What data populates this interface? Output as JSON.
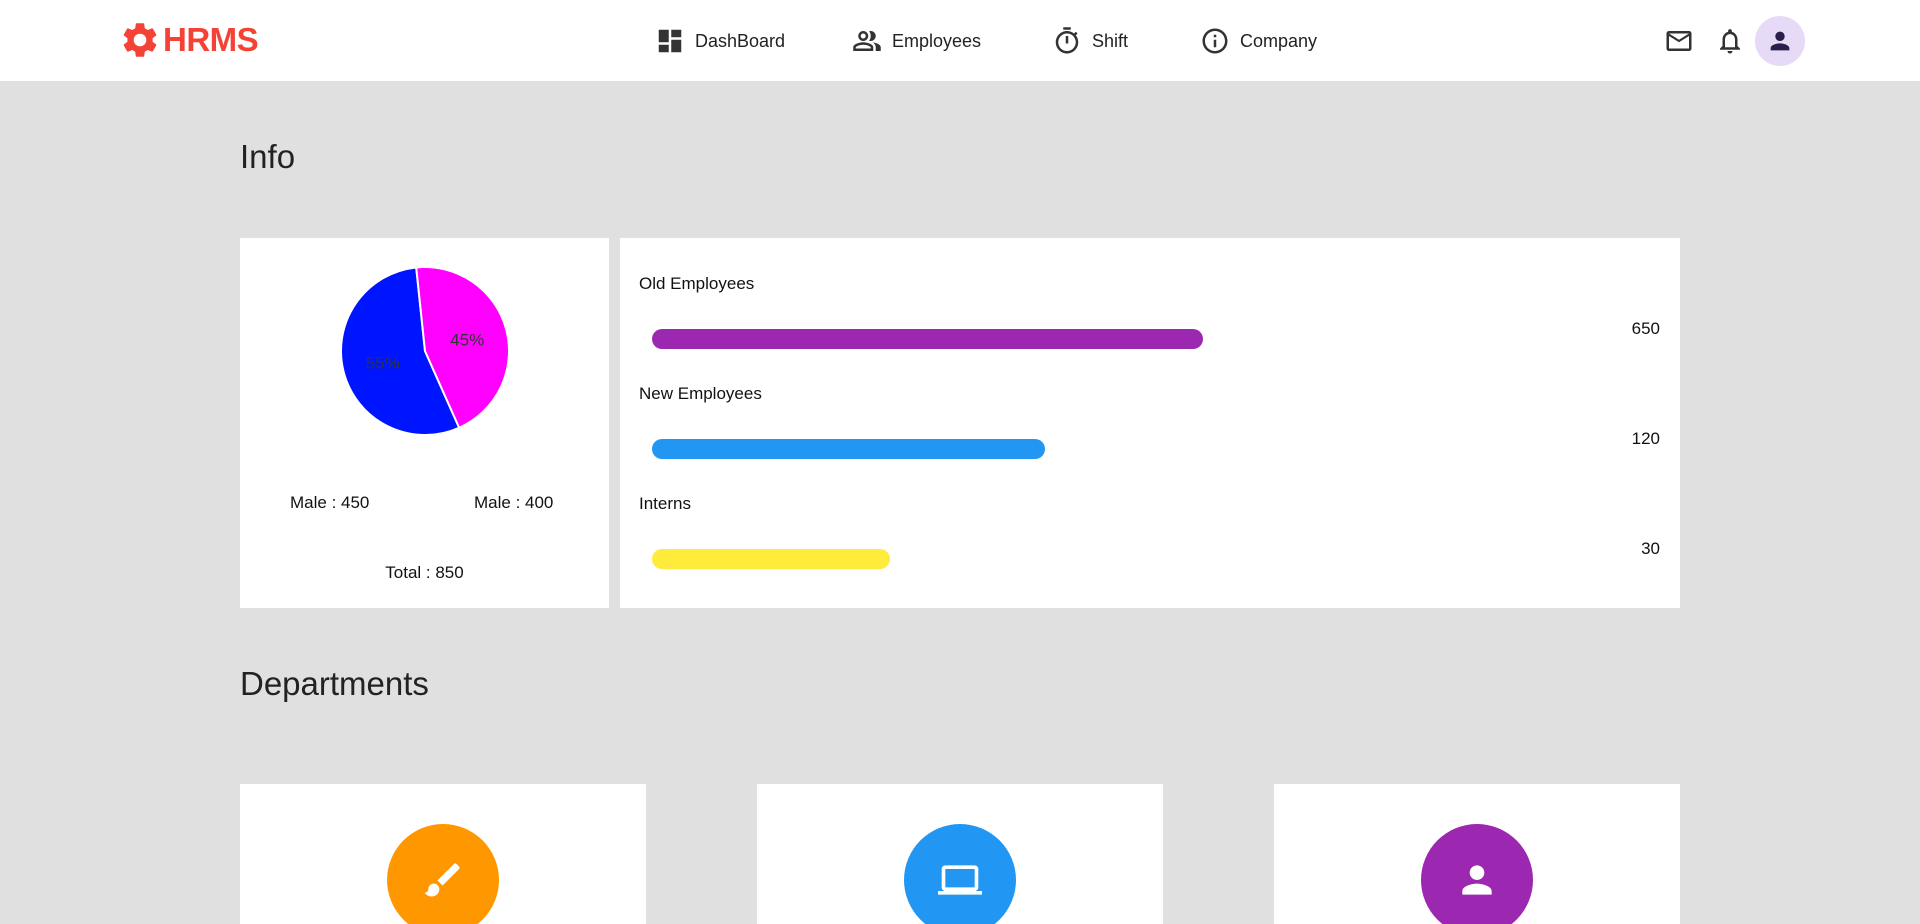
{
  "brand": {
    "name": "HRMS",
    "color": "#f44336",
    "icon": "gear-icon"
  },
  "nav": [
    {
      "label": "DashBoard",
      "icon": "dashboard-icon"
    },
    {
      "label": "Employees",
      "icon": "people-icon"
    },
    {
      "label": "Shift",
      "icon": "timer-icon"
    },
    {
      "label": "Company",
      "icon": "info-icon"
    }
  ],
  "header_icons": [
    "mail-icon",
    "bell-icon",
    "account-avatar-icon"
  ],
  "info": {
    "title": "Info",
    "chart_data": {
      "type": "pie",
      "slices": [
        {
          "label": "55%",
          "value": 55,
          "color": "#0015ff"
        },
        {
          "label": "45%",
          "value": 45,
          "color": "#ff00ff"
        }
      ]
    },
    "gender_a": "Male : 450",
    "gender_b": "Male : 400",
    "total": "Total : 850",
    "bars": [
      {
        "label": "Old Employees",
        "value": "650",
        "fraction": 0.565,
        "color": "#9c27b0"
      },
      {
        "label": "New Employees",
        "value": "120",
        "fraction": 0.403,
        "color": "#2196f3"
      },
      {
        "label": "Interns",
        "value": "30",
        "fraction": 0.244,
        "color": "#ffeb3b"
      }
    ]
  },
  "departments": {
    "title": "Departments",
    "cards": [
      {
        "icon": "brush-icon",
        "color": "#ff9800"
      },
      {
        "icon": "laptop-icon",
        "color": "#2196f3"
      },
      {
        "icon": "person-icon",
        "color": "#9c27b0"
      }
    ]
  }
}
